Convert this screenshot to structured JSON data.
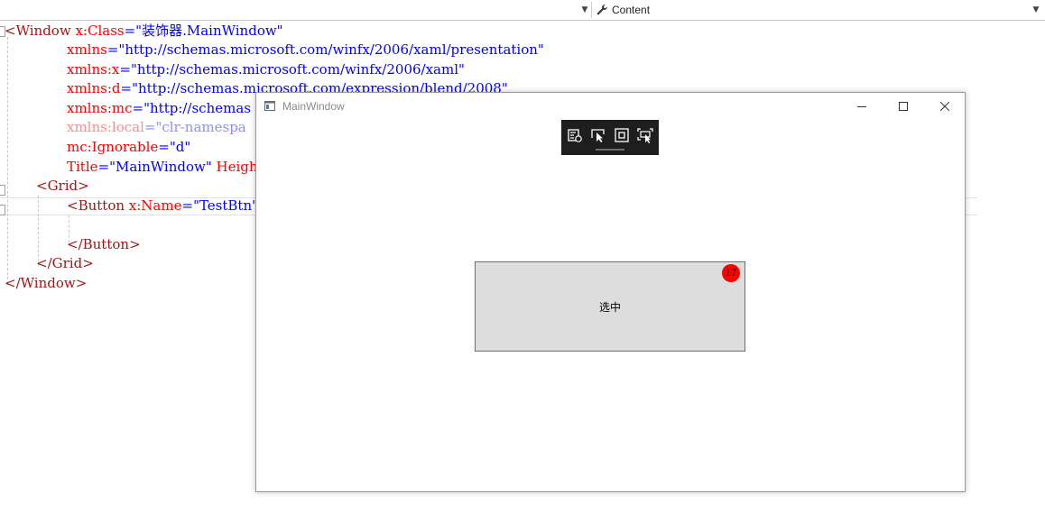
{
  "topbar": {
    "member_label": "Content",
    "wrench_icon": "wrench-icon",
    "dropdown_icon": "chevron-down-icon"
  },
  "editor": {
    "lines": [
      {
        "p1": "<",
        "el": "Window",
        "sp": " ",
        "at": "x:Class",
        "eq": "=",
        "vl": "\"装饰器.MainWindow\""
      },
      {
        "at": "xmlns",
        "eq": "=",
        "vl": "\"http://schemas.microsoft.com/winfx/2006/xaml/presentation\""
      },
      {
        "at": "xmlns:x",
        "eq": "=",
        "vl": "\"http://schemas.microsoft.com/winfx/2006/xaml\""
      },
      {
        "at": "xmlns:d",
        "eq": "=",
        "vl": "\"http://schemas.microsoft.com/expression/blend/2008\""
      },
      {
        "at": "xmlns:mc",
        "eq": "=",
        "vl": "\"http://schemas"
      },
      {
        "at": "xmlns:local",
        "eq": "=",
        "vl": "\"clr-namespa"
      },
      {
        "at": "mc:Ignorable",
        "eq": "=",
        "vl": "\"d\""
      },
      {
        "at": "Title",
        "eq": "=",
        "vl": "\"MainWindow\"",
        "sp": " ",
        "at2": "Heigh"
      },
      {
        "p1": "<",
        "el": "Grid",
        "p2": ">"
      },
      {
        "p1": "<",
        "el": "Button",
        "sp": " ",
        "at": "x:Name",
        "eq": "=",
        "vl": "\"TestBtn\""
      },
      {},
      {
        "p1": "</",
        "el": "Button",
        "p2": ">"
      },
      {
        "p1": "</",
        "el": "Grid",
        "p2": ">"
      },
      {
        "p1": "</",
        "el": "Window",
        "p2": ">"
      }
    ]
  },
  "window": {
    "title": "MainWindow",
    "minimize_icon": "minimize-icon",
    "maximize_icon": "maximize-icon",
    "close_icon": "close-icon"
  },
  "app_toolbar": {
    "buttons": [
      "live-visual-tree-icon",
      "select-element-icon",
      "display-adorners-icon",
      "track-focus-icon"
    ]
  },
  "test_button": {
    "label": "选中",
    "badge": "17"
  }
}
